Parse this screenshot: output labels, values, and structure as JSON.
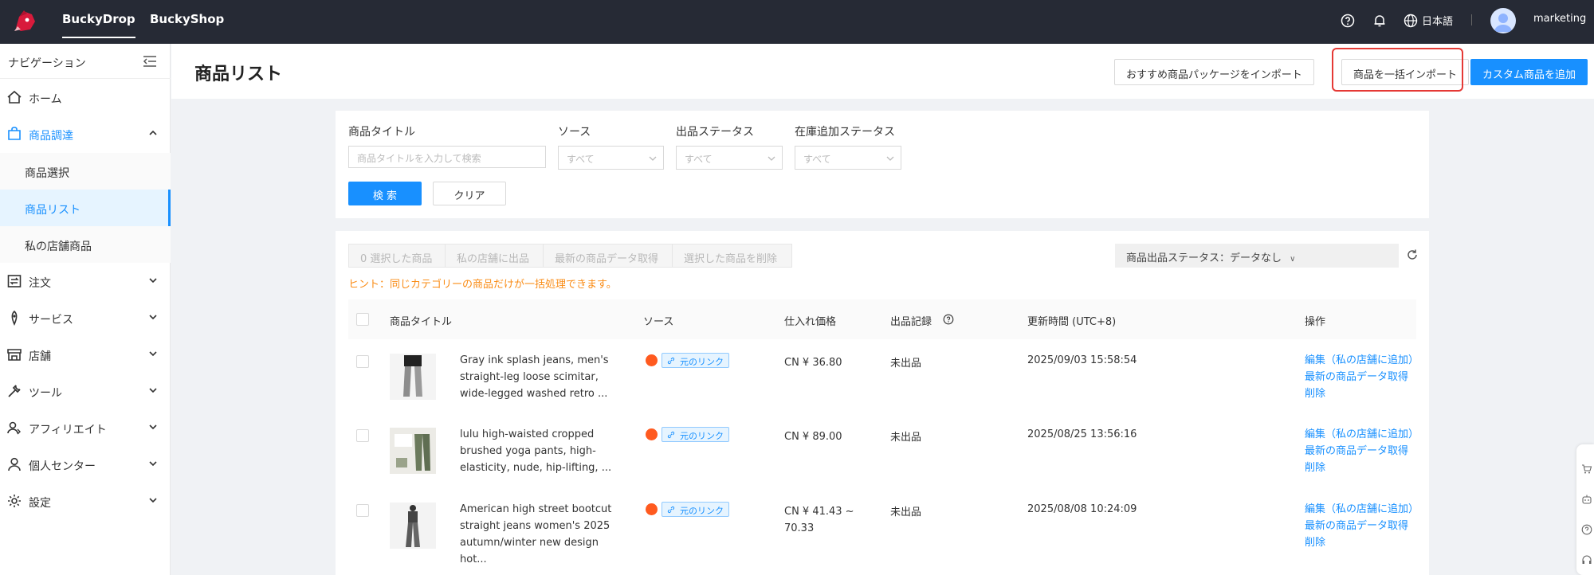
{
  "topbar": {
    "tabs": [
      "BuckyDrop",
      "BuckyShop"
    ],
    "language": "日本語",
    "user": "marketing",
    "icons": [
      "help-icon",
      "bell-icon",
      "globe-icon"
    ]
  },
  "sidebar": {
    "header": "ナビゲーション",
    "items": [
      {
        "label": "ホーム",
        "icon": "home-icon"
      },
      {
        "label": "商品調達",
        "icon": "bag-icon",
        "expanded": true
      },
      {
        "label": "注文",
        "icon": "orders-icon"
      },
      {
        "label": "サービス",
        "icon": "service-icon"
      },
      {
        "label": "店舗",
        "icon": "store-icon"
      },
      {
        "label": "ツール",
        "icon": "tool-icon"
      },
      {
        "label": "アフィリエイト",
        "icon": "affiliate-icon"
      },
      {
        "label": "個人センター",
        "icon": "user-icon"
      },
      {
        "label": "設定",
        "icon": "settings-icon"
      }
    ],
    "sub_items": [
      {
        "label": "商品選択"
      },
      {
        "label": "商品リスト",
        "active": true
      },
      {
        "label": "私の店舗商品"
      }
    ]
  },
  "header": {
    "title": "商品リスト",
    "btn_import_package": "おすすめ商品パッケージをインポート",
    "btn_bulk_import": "商品を一括インポート",
    "btn_add_custom": "カスタム商品を追加"
  },
  "filters": {
    "title_label": "商品タイトル",
    "title_placeholder": "商品タイトルを入力して検索",
    "source_label": "ソース",
    "source_value": "すべて",
    "listing_label": "出品ステータス",
    "listing_value": "すべて",
    "stock_label": "在庫追加ステータス",
    "stock_value": "すべて",
    "search_button": "検 索",
    "clear_button": "クリア"
  },
  "toolbar": {
    "selected": "0 選択した商品",
    "list_to_store": "私の店舗に出品",
    "fetch_latest": "最新の商品データ取得",
    "delete_selected": "選択した商品を削除",
    "status_filter": "商品出品ステータス：データなし",
    "hint": "ヒント：同じカテゴリーの商品だけが一括処理できます。"
  },
  "table": {
    "columns": [
      "商品タイトル",
      "ソース",
      "仕入れ価格",
      "出品記録",
      "更新時間 (UTC+8)",
      "操作"
    ],
    "rows": [
      {
        "title": "Gray ink splash jeans, men's straight-leg loose scimitar, wide-legged washed retro ...",
        "source_link": "元のリンク",
        "price": "CN ¥ 36.80",
        "listing": "未出品",
        "updated": "2025/09/03 15:58:54",
        "action_edit": "編集（私の店舗に追加）",
        "action_fetch": "最新の商品データ取得",
        "action_delete": "削除"
      },
      {
        "title": "lulu high-waisted cropped brushed yoga pants, high-elasticity, nude, hip-lifting, ...",
        "source_link": "元のリンク",
        "price": "CN ¥ 89.00",
        "listing": "未出品",
        "updated": "2025/08/25 13:56:16",
        "action_edit": "編集（私の店舗に追加）",
        "action_fetch": "最新の商品データ取得",
        "action_delete": "削除"
      },
      {
        "title": "American high street bootcut straight jeans women's 2025 autumn/winter new design hot...",
        "source_link": "元のリンク",
        "price": "CN ¥ 41.43 ~ 70.33",
        "listing": "未出品",
        "updated": "2025/08/08 10:24:09",
        "action_edit": "編集（私の店舗に追加）",
        "action_fetch": "最新の商品データ取得",
        "action_delete": "削除"
      }
    ]
  },
  "colors": {
    "accent": "#1890ff",
    "topbar": "#262a35",
    "hint": "#fa8c16",
    "highlight": "#e53935",
    "source_brand": "#ff5a1f"
  }
}
